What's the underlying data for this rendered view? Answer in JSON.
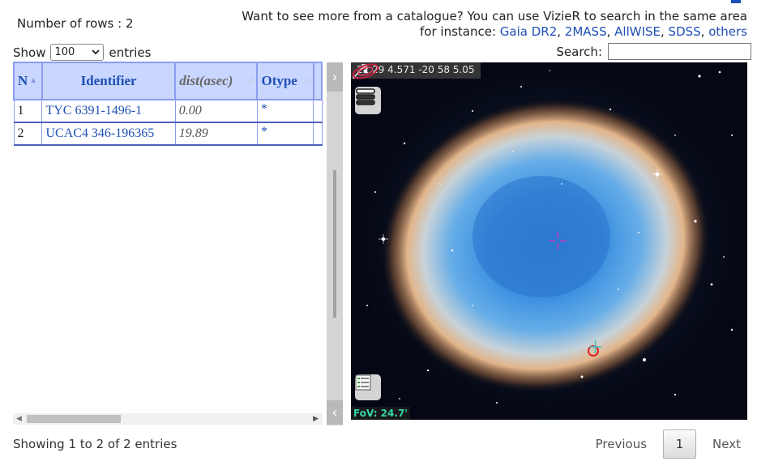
{
  "header": {
    "rows_count": "Number of rows : 2",
    "promo_line1": "Want to see more from a catalogue? You can use VizieR to search in the same area",
    "promo_prefix": "for instance: ",
    "catalogues": [
      "Gaia DR2",
      "2MASS",
      "AllWISE",
      "SDSS",
      "others"
    ],
    "separator": ", "
  },
  "length_menu": {
    "show_label": "Show",
    "selected": "100",
    "entries_label": "entries"
  },
  "search": {
    "label": "Search:",
    "value": ""
  },
  "table": {
    "columns": [
      "N",
      "Identifier",
      "dist(asec)",
      "Otype"
    ],
    "rows": [
      {
        "n": "1",
        "identifier": "TYC 6391-1496-1",
        "dist": "0.00",
        "otype": "*"
      },
      {
        "n": "2",
        "identifier": "UCAC4 346-196365",
        "dist": "19.89",
        "otype": "*"
      }
    ]
  },
  "viewer": {
    "coordinates": "22 29 4.571 -20 58 5.05",
    "fov": "FoV: 24.7'",
    "layers_icon": "layers-icon",
    "list_icon": "catalog-list-icon",
    "expand_icon": "fullscreen-icon",
    "logo_icon": "aladin-logo-icon"
  },
  "footer": {
    "info": "Showing 1 to 2 of 2 entries",
    "previous": "Previous",
    "current_page": "1",
    "next": "Next"
  },
  "colors": {
    "link": "#1f4fb4",
    "header_bg": "#c9d6ff",
    "header_border": "#8c9cf2",
    "fov_text": "#36d6a0"
  }
}
